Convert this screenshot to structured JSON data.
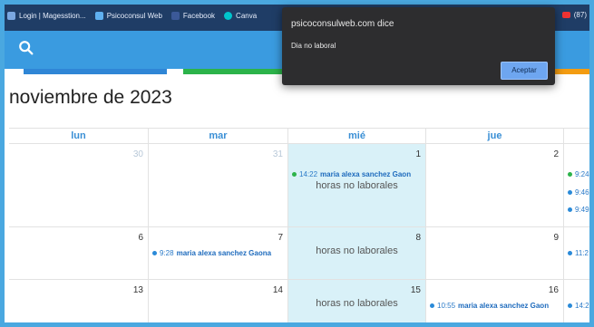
{
  "browser": {
    "bookmarks": [
      {
        "label": "Login | Magesstion...",
        "icon": "bookmark-icon",
        "color": "#7aa7e0"
      },
      {
        "label": "Psicoconsul Web",
        "icon": "bookmark-icon",
        "color": "#5fb0f0"
      },
      {
        "label": "Facebook",
        "icon": "facebook-icon",
        "color": "#3b5998"
      },
      {
        "label": "Canva",
        "icon": "canva-icon",
        "color": "#00c4cc"
      }
    ],
    "right_label": "(87)"
  },
  "dialog": {
    "title": "psicoconsulweb.com dice",
    "message": "Dia no laboral",
    "ok_label": "Aceptar"
  },
  "calendar": {
    "month_title": "noviembre de 2023",
    "weekdays": [
      "lun",
      "mar",
      "mié",
      "jue"
    ],
    "non_working_label": "horas no laborales",
    "event_name": "maria alexa sanchez Gaon",
    "event_name_full": "maria alexa sanchez Gaona",
    "days": {
      "r1": [
        "30",
        "31",
        "1",
        "2"
      ],
      "r2": [
        "6",
        "7",
        "8",
        "9"
      ],
      "r3": [
        "13",
        "14",
        "15",
        "16"
      ]
    },
    "events": {
      "wed1": "14:22",
      "tue7": "9:28",
      "thu16": "10:55",
      "fri_r1": [
        "9:24",
        "9:46",
        "9:49"
      ],
      "fri_r2": "11:2",
      "fri_r3": "14:2"
    },
    "colors": {
      "green_event": "#2cb34a",
      "blue_event": "#2a8ad8"
    }
  }
}
